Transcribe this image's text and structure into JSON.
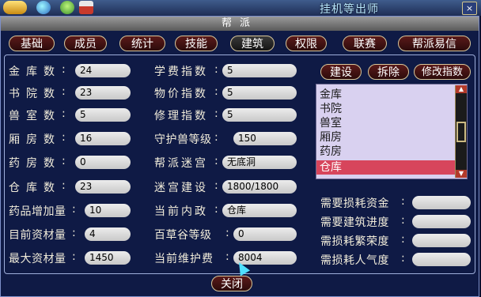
{
  "top": {
    "title": "挂机等出师",
    "close": "×"
  },
  "window": {
    "title": "帮派"
  },
  "tabs": [
    "基础",
    "成员",
    "统计",
    "技能",
    "建筑",
    "权限",
    "联赛",
    "帮派易信"
  ],
  "active_tab": "建筑",
  "col1": [
    {
      "label": "金库数",
      "value": "24"
    },
    {
      "label": "书院数",
      "value": "23"
    },
    {
      "label": "兽室数",
      "value": "5"
    },
    {
      "label": "厢房数",
      "value": "16"
    },
    {
      "label": "药房数",
      "value": "0"
    },
    {
      "label": "仓库数",
      "value": "23"
    },
    {
      "label": "药品增加量",
      "value": "10"
    },
    {
      "label": "目前资材量",
      "value": "4"
    },
    {
      "label": "最大资材量",
      "value": "1450"
    }
  ],
  "col2": [
    {
      "label": "学费指数",
      "value": "5"
    },
    {
      "label": "物价指数",
      "value": "5"
    },
    {
      "label": "修理指数",
      "value": "5"
    },
    {
      "label": "守护兽等级",
      "value": "150"
    },
    {
      "label": "帮派迷宫",
      "value": "无底洞"
    },
    {
      "label": "迷宫建设",
      "value": "1800/1800"
    },
    {
      "label": "当前内政",
      "value": "仓库"
    },
    {
      "label": "百草谷等级",
      "value": "0"
    },
    {
      "label": "当前维护费",
      "value": "8004"
    }
  ],
  "actions": [
    "建设",
    "拆除",
    "修改指数"
  ],
  "building_list": [
    "金库",
    "书院",
    "兽室",
    "厢房",
    "药房",
    "仓库"
  ],
  "selected_building": "仓库",
  "requirements": [
    {
      "label": "需要损耗资金",
      "value": ""
    },
    {
      "label": "需要建筑进度",
      "value": ""
    },
    {
      "label": "需损耗繁荣度",
      "value": ""
    },
    {
      "label": "需损耗人气度",
      "value": ""
    }
  ],
  "close_button": "关闭",
  "colors": {
    "tab_bg": "#3a0f0f",
    "tab_border": "#d8c69a",
    "panel_bg": "#0f1a45",
    "selected_row": "#d7455c",
    "list_bg": "#d9d1f0"
  }
}
